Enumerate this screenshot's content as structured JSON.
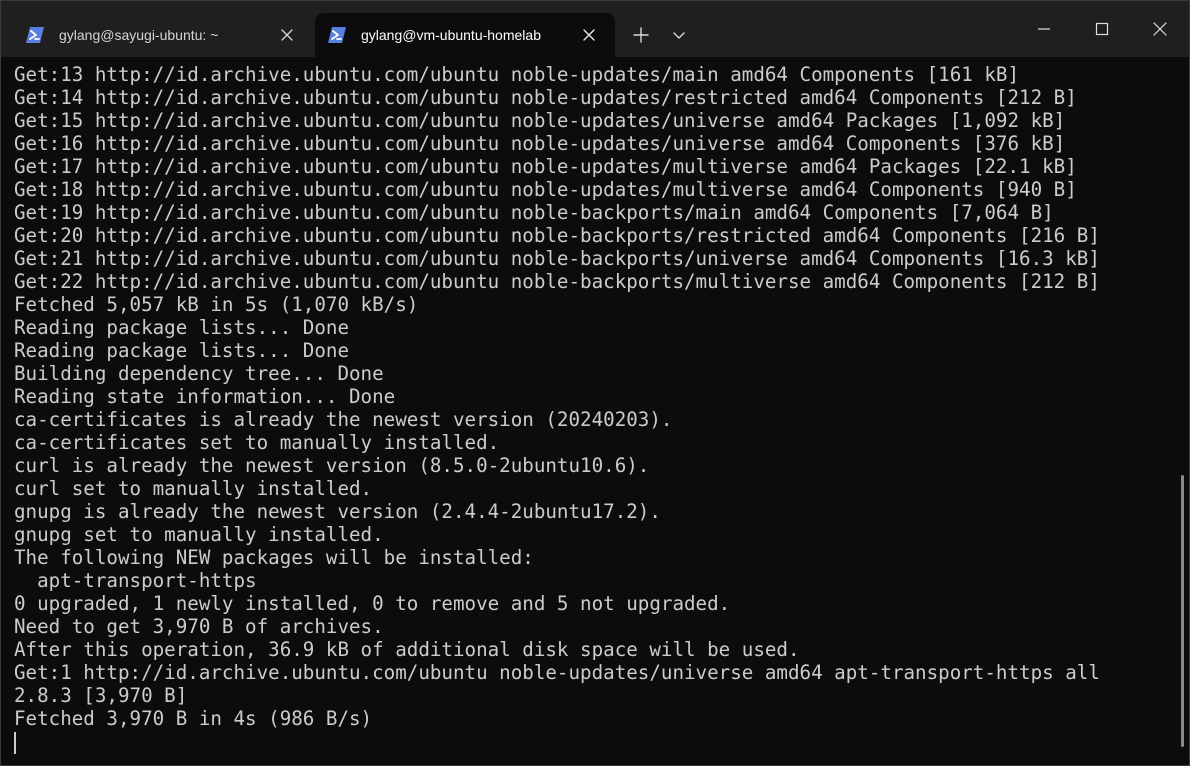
{
  "tabs": [
    {
      "title": "gylang@sayugi-ubuntu: ~",
      "icon": "powershell-icon",
      "active": false
    },
    {
      "title": "gylang@vm-ubuntu-homelab",
      "icon": "powershell-icon",
      "active": true
    }
  ],
  "window_controls": {
    "new_tab_icon": "plus-icon",
    "dropdown_icon": "chevron-down-icon",
    "minimize_icon": "minimize-icon",
    "maximize_icon": "maximize-icon",
    "close_icon": "close-icon"
  },
  "colors": {
    "background": "#0c0c0c",
    "titlebar": "#1f1f1f",
    "text": "#cccccc",
    "ps_icon_blue": "#5b7fe0"
  },
  "terminal": {
    "lines": [
      "Get:13 http://id.archive.ubuntu.com/ubuntu noble-updates/main amd64 Components [161 kB]",
      "Get:14 http://id.archive.ubuntu.com/ubuntu noble-updates/restricted amd64 Components [212 B]",
      "Get:15 http://id.archive.ubuntu.com/ubuntu noble-updates/universe amd64 Packages [1,092 kB]",
      "Get:16 http://id.archive.ubuntu.com/ubuntu noble-updates/universe amd64 Components [376 kB]",
      "Get:17 http://id.archive.ubuntu.com/ubuntu noble-updates/multiverse amd64 Packages [22.1 kB]",
      "Get:18 http://id.archive.ubuntu.com/ubuntu noble-updates/multiverse amd64 Components [940 B]",
      "Get:19 http://id.archive.ubuntu.com/ubuntu noble-backports/main amd64 Components [7,064 B]",
      "Get:20 http://id.archive.ubuntu.com/ubuntu noble-backports/restricted amd64 Components [216 B]",
      "Get:21 http://id.archive.ubuntu.com/ubuntu noble-backports/universe amd64 Components [16.3 kB]",
      "Get:22 http://id.archive.ubuntu.com/ubuntu noble-backports/multiverse amd64 Components [212 B]",
      "Fetched 5,057 kB in 5s (1,070 kB/s)",
      "Reading package lists... Done",
      "Reading package lists... Done",
      "Building dependency tree... Done",
      "Reading state information... Done",
      "ca-certificates is already the newest version (20240203).",
      "ca-certificates set to manually installed.",
      "curl is already the newest version (8.5.0-2ubuntu10.6).",
      "curl set to manually installed.",
      "gnupg is already the newest version (2.4.4-2ubuntu17.2).",
      "gnupg set to manually installed.",
      "The following NEW packages will be installed:",
      "  apt-transport-https",
      "0 upgraded, 1 newly installed, 0 to remove and 5 not upgraded.",
      "Need to get 3,970 B of archives.",
      "After this operation, 36.9 kB of additional disk space will be used.",
      "Get:1 http://id.archive.ubuntu.com/ubuntu noble-updates/universe amd64 apt-transport-https all",
      "2.8.3 [3,970 B]",
      "Fetched 3,970 B in 4s (986 B/s)"
    ]
  }
}
